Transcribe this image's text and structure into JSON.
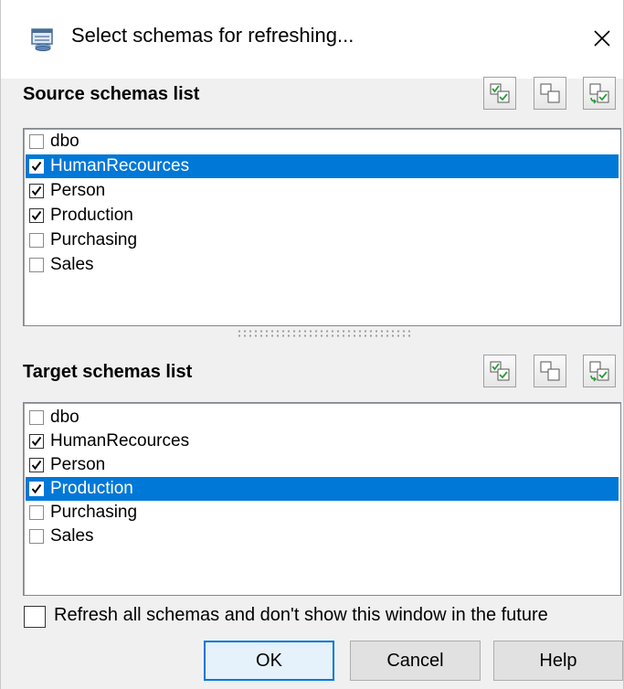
{
  "window": {
    "title": "Select schemas for refreshing...",
    "close_glyph": "✕"
  },
  "source": {
    "label": "Source schemas list",
    "items": [
      {
        "label": "dbo",
        "checked": false,
        "selected": false
      },
      {
        "label": "HumanRecources",
        "checked": true,
        "selected": true
      },
      {
        "label": "Person",
        "checked": true,
        "selected": false
      },
      {
        "label": "Production",
        "checked": true,
        "selected": false
      },
      {
        "label": "Purchasing",
        "checked": false,
        "selected": false
      },
      {
        "label": "Sales",
        "checked": false,
        "selected": false
      }
    ]
  },
  "target": {
    "label": "Target schemas list",
    "items": [
      {
        "label": "dbo",
        "checked": false,
        "selected": false
      },
      {
        "label": "HumanRecources",
        "checked": true,
        "selected": false
      },
      {
        "label": "Person",
        "checked": true,
        "selected": false
      },
      {
        "label": "Production",
        "checked": true,
        "selected": true
      },
      {
        "label": "Purchasing",
        "checked": false,
        "selected": false
      },
      {
        "label": "Sales",
        "checked": false,
        "selected": false
      }
    ]
  },
  "toolbar_icons": [
    "check-all-icon",
    "uncheck-all-icon",
    "invert-selection-icon"
  ],
  "footer": {
    "refresh_all_label": "Refresh all schemas and don't show this window in the future",
    "refresh_all_checked": false
  },
  "buttons": {
    "ok": "OK",
    "cancel": "Cancel",
    "help": "Help"
  },
  "colors": {
    "selection": "#0078d7",
    "icon_green": "#2e9a3a",
    "default_button_border": "#0078d7"
  }
}
